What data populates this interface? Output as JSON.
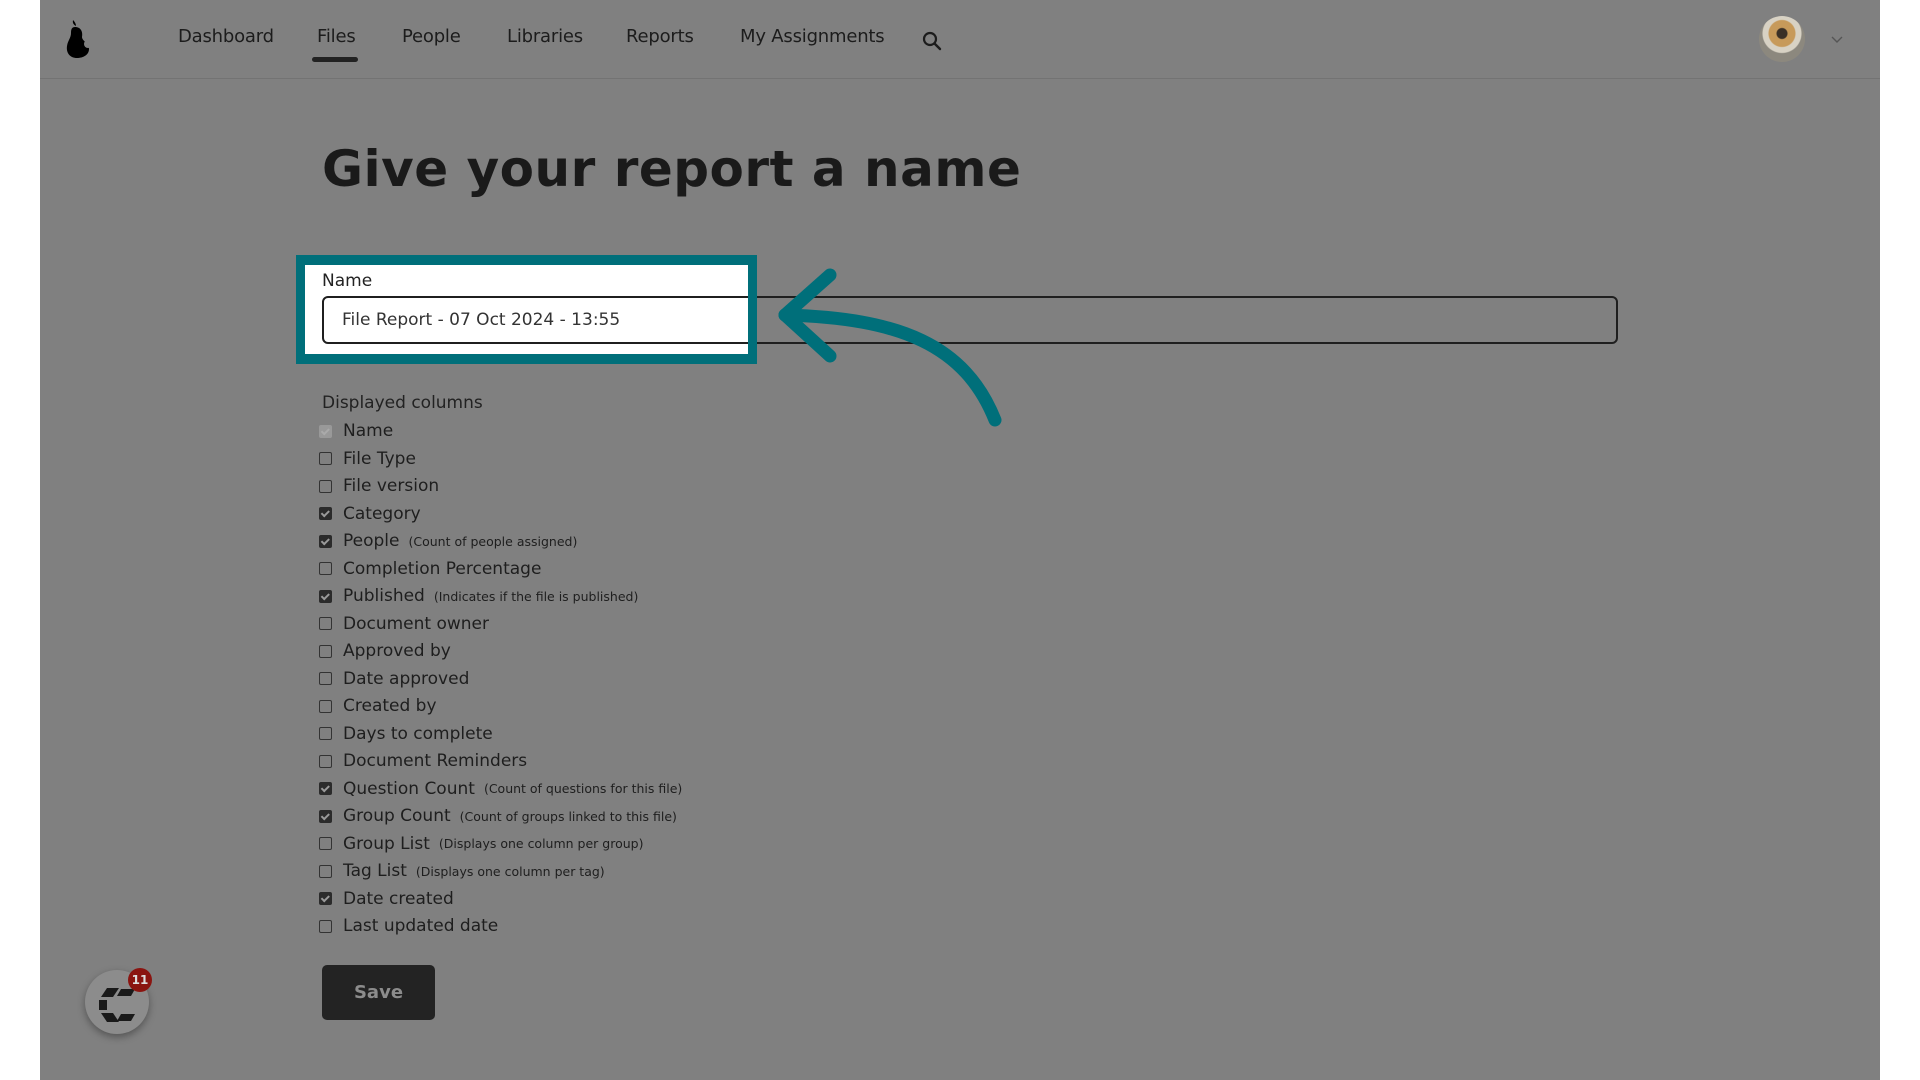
{
  "nav": {
    "items": [
      {
        "label": "Dashboard",
        "active": false
      },
      {
        "label": "Files",
        "active": true
      },
      {
        "label": "People",
        "active": false
      },
      {
        "label": "Libraries",
        "active": false
      },
      {
        "label": "Reports",
        "active": false
      },
      {
        "label": "My Assignments",
        "active": false
      }
    ],
    "search_icon": "search-icon",
    "logo_icon": "pear-logo-icon",
    "avatar_icon": "user-avatar",
    "chevron_icon": "chevron-down-icon"
  },
  "page": {
    "title": "Give your report a name",
    "name_field": {
      "label": "Name",
      "value": "File Report - 07 Oct 2024 - 13:55"
    },
    "columns_label": "Displayed columns",
    "columns": [
      {
        "label": "Name",
        "hint": "",
        "checked": true,
        "disabled": true
      },
      {
        "label": "File Type",
        "hint": "",
        "checked": false
      },
      {
        "label": "File version",
        "hint": "",
        "checked": false
      },
      {
        "label": "Category",
        "hint": "",
        "checked": true
      },
      {
        "label": "People",
        "hint": "(Count of people assigned)",
        "checked": true
      },
      {
        "label": "Completion Percentage",
        "hint": "",
        "checked": false
      },
      {
        "label": "Published",
        "hint": "(Indicates if the file is published)",
        "checked": true
      },
      {
        "label": "Document owner",
        "hint": "",
        "checked": false
      },
      {
        "label": "Approved by",
        "hint": "",
        "checked": false
      },
      {
        "label": "Date approved",
        "hint": "",
        "checked": false
      },
      {
        "label": "Created by",
        "hint": "",
        "checked": false
      },
      {
        "label": "Days to complete",
        "hint": "",
        "checked": false
      },
      {
        "label": "Document Reminders",
        "hint": "",
        "checked": false
      },
      {
        "label": "Question Count",
        "hint": "(Count of questions for this file)",
        "checked": true
      },
      {
        "label": "Group Count",
        "hint": "(Count of groups linked to this file)",
        "checked": true
      },
      {
        "label": "Group List",
        "hint": "(Displays one column per group)",
        "checked": false
      },
      {
        "label": "Tag List",
        "hint": "(Displays one column per tag)",
        "checked": false
      },
      {
        "label": "Date created",
        "hint": "",
        "checked": true
      },
      {
        "label": "Last updated date",
        "hint": "",
        "checked": false
      }
    ],
    "save_label": "Save"
  },
  "chat_widget": {
    "badge_count": "11"
  },
  "annotation": {
    "highlight_color": "#006f7a",
    "arrow_color": "#006f7a"
  }
}
